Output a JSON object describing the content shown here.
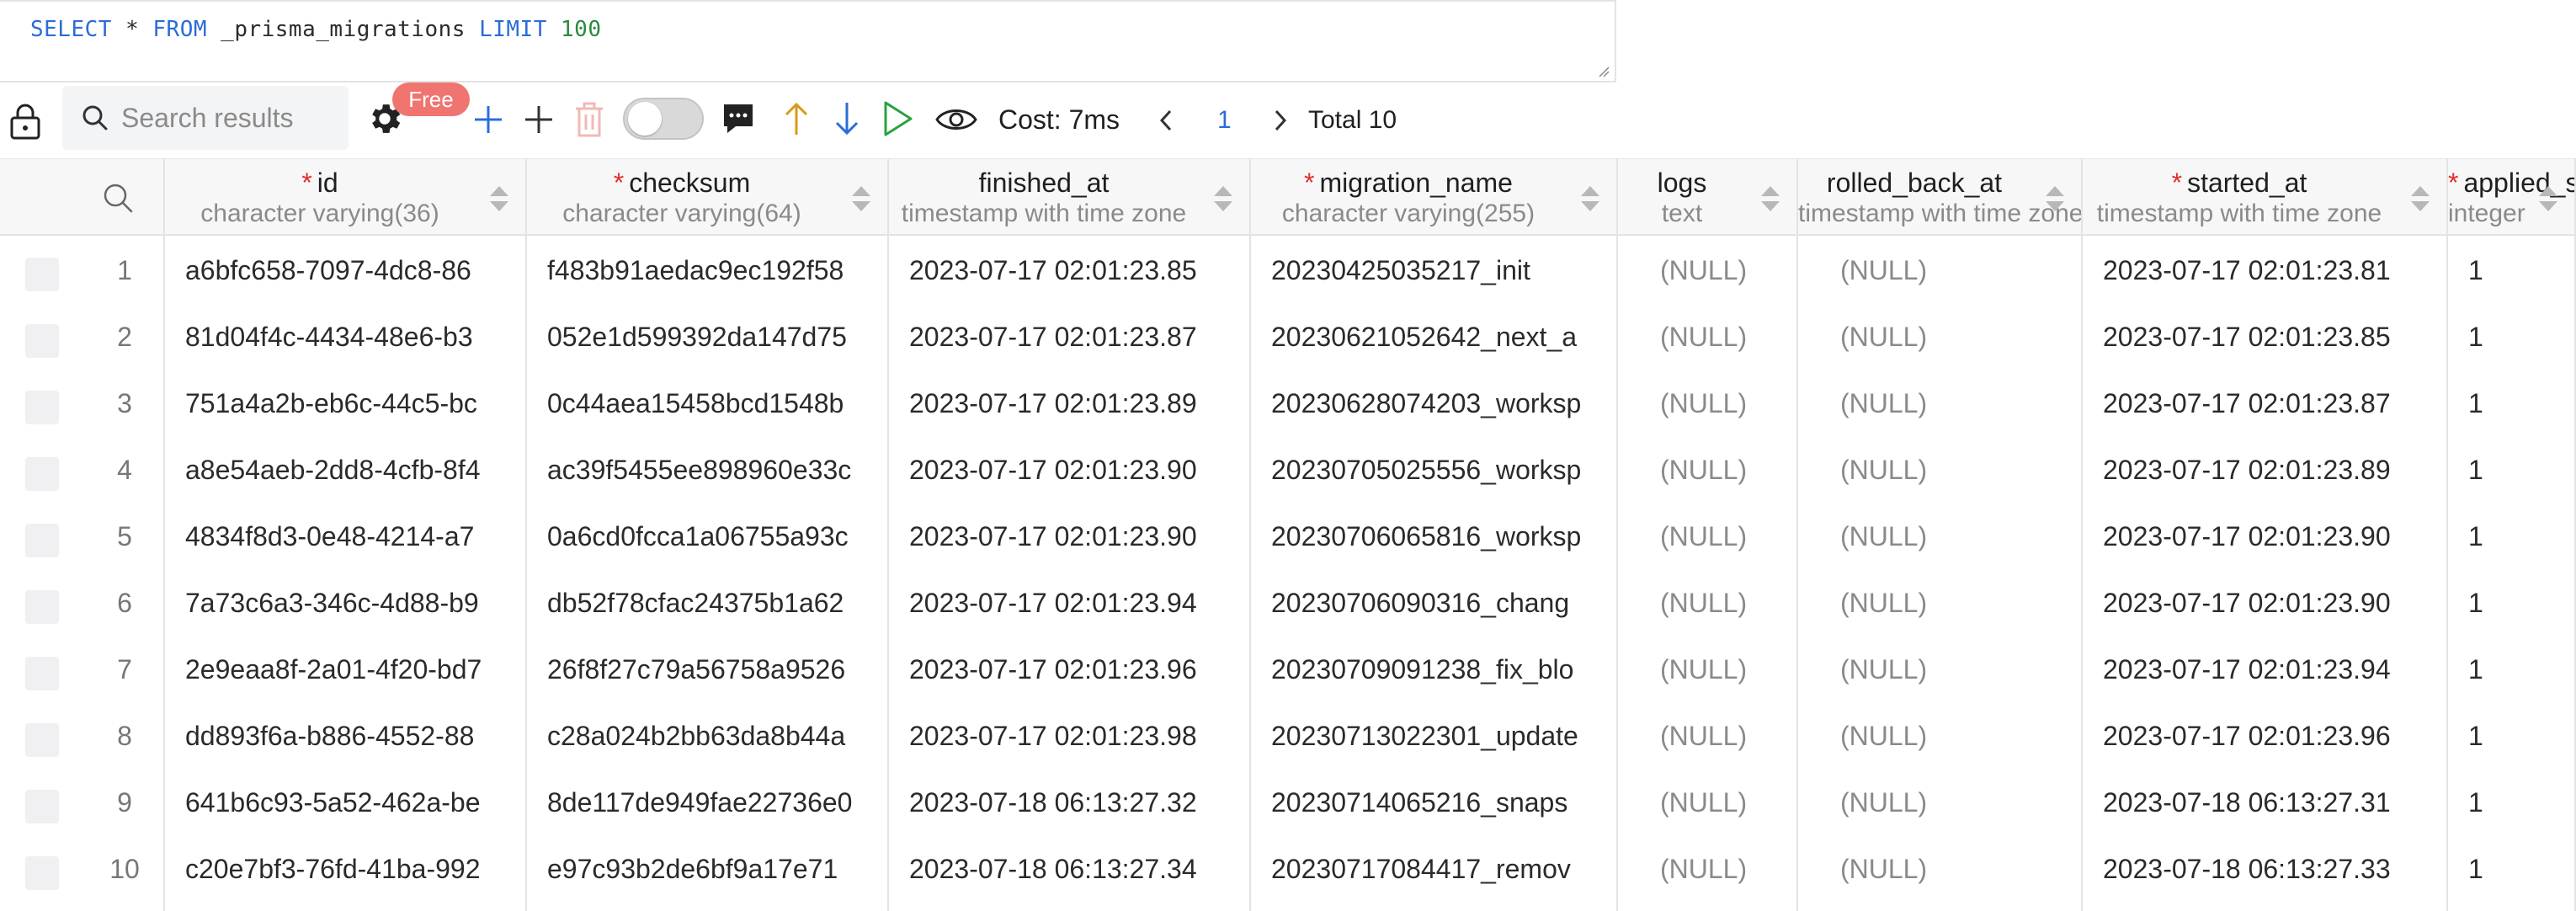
{
  "editor": {
    "sql_tokens": [
      {
        "text": "SELECT",
        "kind": "kw"
      },
      {
        "text": " * ",
        "kind": "plain"
      },
      {
        "text": "FROM",
        "kind": "kw"
      },
      {
        "text": " _prisma_migrations ",
        "kind": "plain"
      },
      {
        "text": "LIMIT",
        "kind": "kw"
      },
      {
        "text": " 100",
        "kind": "num"
      }
    ]
  },
  "toolbar": {
    "search_placeholder": "Search results",
    "free_badge": "Free",
    "cost_label": "Cost: 7ms",
    "page_number": "1",
    "total_label": "Total 10"
  },
  "colors": {
    "accent_blue": "#2b6cd9",
    "keyword_blue": "#2b6cd9",
    "number_green": "#2a8a3e",
    "badge_red": "#f07470",
    "required_star": "#e0302b",
    "arrow_up_orange": "#d99a1b",
    "arrow_down_blue": "#2b6cd9",
    "play_green": "#2aa140",
    "delete_red_disabled": "#f2b8b5"
  },
  "grid": {
    "columns": [
      {
        "name": "id",
        "type": "character varying(36)",
        "required": true
      },
      {
        "name": "checksum",
        "type": "character varying(64)",
        "required": true
      },
      {
        "name": "finished_at",
        "type": "timestamp with time zone",
        "required": false
      },
      {
        "name": "migration_name",
        "type": "character varying(255)",
        "required": true
      },
      {
        "name": "logs",
        "type": "text",
        "required": false
      },
      {
        "name": "rolled_back_at",
        "type": "timestamp with time zone",
        "required": false
      },
      {
        "name": "started_at",
        "type": "timestamp with time zone",
        "required": true
      },
      {
        "name": "applied_steps_count",
        "type": "integer",
        "required": true
      }
    ],
    "rows": [
      {
        "index": "1",
        "cells": [
          "a6bfc658-7097-4dc8-86",
          "f483b91aedac9ec192f58",
          "2023-07-17 02:01:23.85",
          "20230425035217_init",
          "(NULL)",
          "(NULL)",
          "2023-07-17 02:01:23.81",
          "1"
        ]
      },
      {
        "index": "2",
        "cells": [
          "81d04f4c-4434-48e6-b3",
          "052e1d599392da147d75",
          "2023-07-17 02:01:23.87",
          "20230621052642_next_a",
          "(NULL)",
          "(NULL)",
          "2023-07-17 02:01:23.85",
          "1"
        ]
      },
      {
        "index": "3",
        "cells": [
          "751a4a2b-eb6c-44c5-bc",
          "0c44aea15458bcd1548b",
          "2023-07-17 02:01:23.89",
          "20230628074203_worksp",
          "(NULL)",
          "(NULL)",
          "2023-07-17 02:01:23.87",
          "1"
        ]
      },
      {
        "index": "4",
        "cells": [
          "a8e54aeb-2dd8-4cfb-8f4",
          "ac39f5455ee898960e33c",
          "2023-07-17 02:01:23.90",
          "20230705025556_worksp",
          "(NULL)",
          "(NULL)",
          "2023-07-17 02:01:23.89",
          "1"
        ]
      },
      {
        "index": "5",
        "cells": [
          "4834f8d3-0e48-4214-a7",
          "0a6cd0fcca1a06755a93c",
          "2023-07-17 02:01:23.90",
          "20230706065816_worksp",
          "(NULL)",
          "(NULL)",
          "2023-07-17 02:01:23.90",
          "1"
        ]
      },
      {
        "index": "6",
        "cells": [
          "7a73c6a3-346c-4d88-b9",
          "db52f78cfac24375b1a62",
          "2023-07-17 02:01:23.94",
          "20230706090316_chang",
          "(NULL)",
          "(NULL)",
          "2023-07-17 02:01:23.90",
          "1"
        ]
      },
      {
        "index": "7",
        "cells": [
          "2e9eaa8f-2a01-4f20-bd7",
          "26f8f27c79a56758a9526",
          "2023-07-17 02:01:23.96",
          "20230709091238_fix_blo",
          "(NULL)",
          "(NULL)",
          "2023-07-17 02:01:23.94",
          "1"
        ]
      },
      {
        "index": "8",
        "cells": [
          "dd893f6a-b886-4552-88",
          "c28a024b2bb63da8b44a",
          "2023-07-17 02:01:23.98",
          "20230713022301_update",
          "(NULL)",
          "(NULL)",
          "2023-07-17 02:01:23.96",
          "1"
        ]
      },
      {
        "index": "9",
        "cells": [
          "641b6c93-5a52-462a-be",
          "8de117de949fae22736e0",
          "2023-07-18 06:13:27.32",
          "20230714065216_snaps",
          "(NULL)",
          "(NULL)",
          "2023-07-18 06:13:27.31",
          "1"
        ]
      },
      {
        "index": "10",
        "cells": [
          "c20e7bf3-76fd-41ba-992",
          "e97c93b2de6bf9a17e71",
          "2023-07-18 06:13:27.34",
          "20230717084417_remov",
          "(NULL)",
          "(NULL)",
          "2023-07-18 06:13:27.33",
          "1"
        ]
      }
    ]
  }
}
